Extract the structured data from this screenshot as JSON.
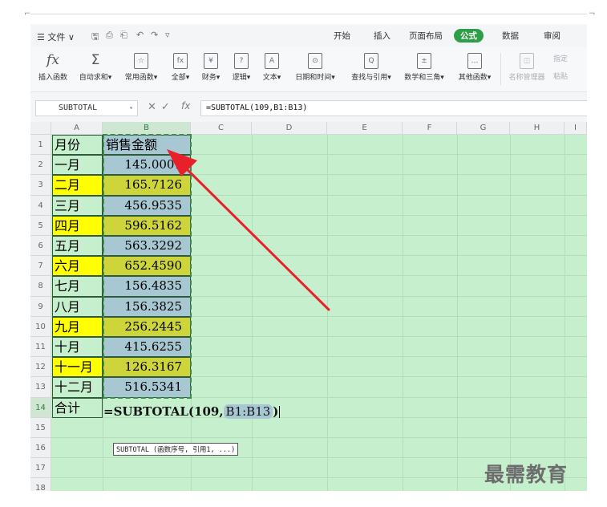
{
  "menu": {
    "file_label": "☰ 文件 ∨",
    "quick_access": [
      "🖫",
      "⎙",
      "⎗",
      "↶",
      "↷",
      "▿"
    ],
    "tabs": [
      "开始",
      "插入",
      "页面布局",
      "公式",
      "数据",
      "审阅"
    ],
    "active_tab": "公式"
  },
  "ribbon": {
    "buttons": [
      {
        "icon": "fx",
        "label": "插入函数"
      },
      {
        "icon": "Σ",
        "label": "自动求和▾"
      },
      {
        "icon": "☆",
        "label": "常用函数▾"
      },
      {
        "icon": "fx",
        "label": "全部▾"
      },
      {
        "icon": "¥",
        "label": "财务▾"
      },
      {
        "icon": "?",
        "label": "逻辑▾"
      },
      {
        "icon": "A",
        "label": "文本▾"
      },
      {
        "icon": "⊙",
        "label": "日期和时间▾"
      },
      {
        "icon": "Q",
        "label": "查找与引用▾"
      },
      {
        "icon": "±",
        "label": "数学和三角▾"
      },
      {
        "icon": "…",
        "label": "其他函数▾"
      },
      {
        "icon": "◫",
        "label": "名称管理器"
      }
    ],
    "side_top": "指定",
    "side_bottom": "粘贴"
  },
  "formula_bar": {
    "name_box": "SUBTOTAL",
    "name_dropdown": "▾",
    "cancel": "✕",
    "confirm": "✓",
    "fx": "fx",
    "formula": "=SUBTOTAL(109,B1:B13)"
  },
  "sheet": {
    "columns": [
      "A",
      "B",
      "C",
      "D",
      "E",
      "F",
      "G",
      "H",
      "I"
    ],
    "row_numbers": [
      "1",
      "2",
      "3",
      "4",
      "5",
      "6",
      "7",
      "8",
      "9",
      "10",
      "11",
      "12",
      "13",
      "14",
      "15",
      "16",
      "17",
      "18"
    ],
    "header": {
      "a": "月份",
      "b": "销售金额"
    },
    "rows": [
      {
        "month": "一月",
        "amount": "145.0001",
        "highlight": false
      },
      {
        "month": "二月",
        "amount": "165.7126",
        "highlight": true
      },
      {
        "month": "三月",
        "amount": "456.9535",
        "highlight": false
      },
      {
        "month": "四月",
        "amount": "596.5162",
        "highlight": true
      },
      {
        "month": "五月",
        "amount": "563.3292",
        "highlight": false
      },
      {
        "month": "六月",
        "amount": "652.4590",
        "highlight": true
      },
      {
        "month": "七月",
        "amount": "156.4835",
        "highlight": false
      },
      {
        "month": "八月",
        "amount": "156.3825",
        "highlight": false
      },
      {
        "month": "九月",
        "amount": "256.2445",
        "highlight": true
      },
      {
        "month": "十月",
        "amount": "415.6255",
        "highlight": false
      },
      {
        "month": "十一月",
        "amount": "126.3167",
        "highlight": true
      },
      {
        "month": "十二月",
        "amount": "516.5341",
        "highlight": false
      }
    ],
    "total_label": "合计",
    "edit_prefix": "=SUBTOTAL(109,",
    "edit_ref": "B1:B13",
    "edit_suffix": ")",
    "tooltip": "SUBTOTAL (函数序号, 引用1, ...)"
  },
  "watermark": "最需教育",
  "colors": {
    "accent": "#2e9e48",
    "yellow": "#ffff00",
    "arrow": "#e8202a"
  }
}
